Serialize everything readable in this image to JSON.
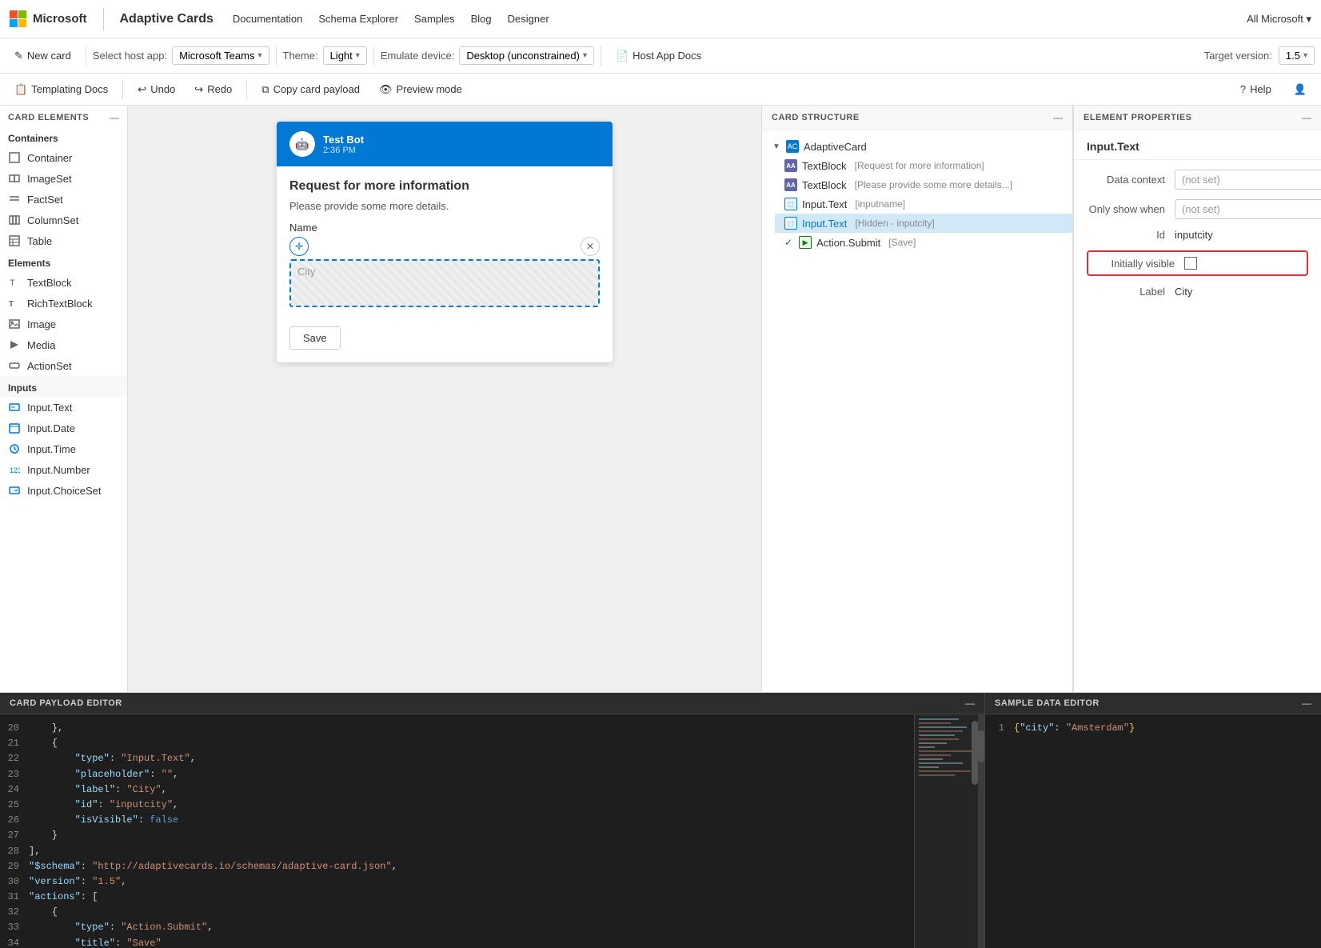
{
  "topnav": {
    "brand": "Microsoft",
    "app_name": "Adaptive Cards",
    "links": [
      "Documentation",
      "Schema Explorer",
      "Samples",
      "Blog",
      "Designer"
    ],
    "right": "All Microsoft ▾"
  },
  "toolbar1": {
    "new_card": "New card",
    "host_app_label": "Select host app:",
    "host_app_value": "Microsoft Teams",
    "theme_label": "Theme:",
    "theme_value": "Light",
    "device_label": "Emulate device:",
    "device_value": "Desktop (unconstrained)",
    "host_app_docs": "Host App Docs",
    "target_version_label": "Target version:",
    "target_version_value": "1.5"
  },
  "toolbar2": {
    "templating_docs": "Templating Docs",
    "undo": "Undo",
    "redo": "Redo",
    "copy_card_payload": "Copy card payload",
    "preview_mode": "Preview mode",
    "help": "Help"
  },
  "left_panel": {
    "section_card_elements": "CARD ELEMENTS",
    "containers": {
      "title": "Containers",
      "items": [
        "Container",
        "ImageSet",
        "FactSet",
        "ColumnSet",
        "Table"
      ]
    },
    "elements": {
      "title": "Elements",
      "items": [
        "TextBlock",
        "RichTextBlock",
        "Image",
        "Media",
        "ActionSet"
      ]
    },
    "inputs": {
      "title": "Inputs",
      "items": [
        "Input.Text",
        "Input.Date",
        "Input.Time",
        "Input.Number",
        "Input.ChoiceSet"
      ]
    }
  },
  "card_preview": {
    "header_name": "Test Bot",
    "header_time": "2:36 PM",
    "title": "Request for more information",
    "subtitle": "Please provide some more details.",
    "name_label": "Name",
    "city_placeholder": "City",
    "save_button": "Save"
  },
  "card_structure": {
    "title": "CARD STRUCTURE",
    "items": [
      {
        "type": "AdaptiveCard",
        "label": "",
        "indent": 0,
        "icon": "root",
        "expanded": true
      },
      {
        "type": "TextBlock",
        "label": "[Request for more information]",
        "indent": 1,
        "icon": "aa"
      },
      {
        "type": "TextBlock",
        "label": "[Please provide some more details...]",
        "indent": 1,
        "icon": "aa"
      },
      {
        "type": "Input.Text",
        "label": "[inputname]",
        "indent": 1,
        "icon": "input"
      },
      {
        "type": "Input.Text",
        "label": "[Hidden - inputcity]",
        "indent": 1,
        "icon": "input",
        "selected": true
      },
      {
        "type": "Action.Submit",
        "label": "[Save]",
        "indent": 1,
        "icon": "action",
        "checked": true
      }
    ]
  },
  "element_properties": {
    "title": "ELEMENT PROPERTIES",
    "element_name": "Input.Text",
    "fields": [
      {
        "label": "Data context",
        "value": "(not set)",
        "type": "input"
      },
      {
        "label": "Only show when",
        "value": "(not set)",
        "type": "input"
      },
      {
        "label": "Id",
        "value": "inputcity",
        "type": "text"
      },
      {
        "label": "Initially visible",
        "value": "",
        "type": "checkbox"
      },
      {
        "label": "Label",
        "value": "City",
        "type": "text"
      }
    ]
  },
  "card_payload_editor": {
    "title": "CARD PAYLOAD EDITOR",
    "lines": [
      {
        "num": 20,
        "content": "    },"
      },
      {
        "num": 21,
        "content": "    {"
      },
      {
        "num": 22,
        "content": "        \"type\": \"Input.Text\","
      },
      {
        "num": 23,
        "content": "        \"placeholder\": \"\","
      },
      {
        "num": 24,
        "content": "        \"label\": \"City\","
      },
      {
        "num": 25,
        "content": "        \"id\": \"inputcity\","
      },
      {
        "num": 26,
        "content": "        \"isVisible\": false"
      },
      {
        "num": 27,
        "content": "    }"
      },
      {
        "num": 28,
        "content": "],"
      },
      {
        "num": 29,
        "content": "\"$schema\": \"http://adaptivecards.io/schemas/adaptive-card.json\","
      },
      {
        "num": 30,
        "content": "\"version\": \"1.5\","
      },
      {
        "num": 31,
        "content": "\"actions\": ["
      },
      {
        "num": 32,
        "content": "    {"
      },
      {
        "num": 33,
        "content": "        \"type\": \"Action.Submit\","
      },
      {
        "num": 34,
        "content": "        \"title\": \"Save\""
      }
    ]
  },
  "sample_data_editor": {
    "title": "SAMPLE DATA EDITOR",
    "lines": [
      {
        "num": 1,
        "content": "{\"city\": \"Amsterdam\"}"
      }
    ]
  }
}
